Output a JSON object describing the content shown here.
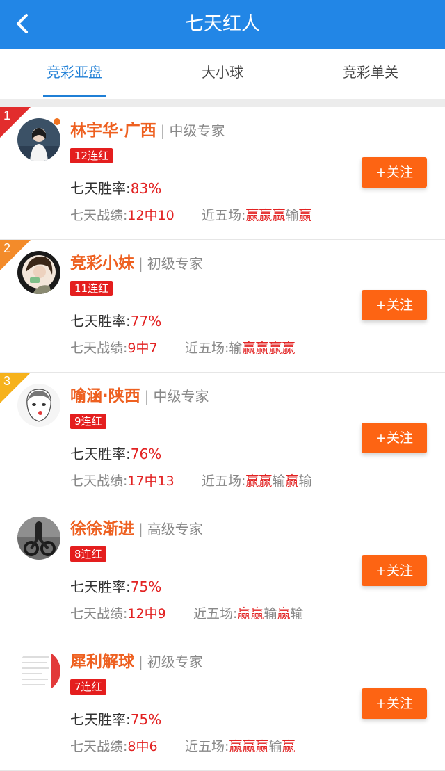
{
  "header": {
    "title": "七天红人",
    "back_icon": "chevron-left-icon",
    "color": "#2286e6"
  },
  "tabs": [
    {
      "label": "竞彩亚盘",
      "active": true
    },
    {
      "label": "大小球",
      "active": false
    },
    {
      "label": "竞彩单关",
      "active": false
    }
  ],
  "labels": {
    "winrate": "七天胜率:",
    "record": "七天战绩:",
    "recent": "近五场:",
    "follow": "+关注",
    "separator": "|"
  },
  "colors": {
    "accent": "#fd6413",
    "win": "#e22222",
    "tab_active": "#1f7fd6"
  },
  "experts": [
    {
      "rank": "1",
      "name": "林宇华·广西",
      "level": "中级专家",
      "streak": "12连红",
      "winrate": "83%",
      "record": "12中10",
      "recent": [
        "赢",
        "赢",
        "赢",
        "输",
        "赢"
      ],
      "online": true
    },
    {
      "rank": "2",
      "name": "竞彩小妹",
      "level": "初级专家",
      "streak": "11连红",
      "winrate": "77%",
      "record": "9中7",
      "recent": [
        "输",
        "赢",
        "赢",
        "赢",
        "赢"
      ],
      "online": false
    },
    {
      "rank": "3",
      "name": "喻涵·陕西",
      "level": "中级专家",
      "streak": "9连红",
      "winrate": "76%",
      "record": "17中13",
      "recent": [
        "赢",
        "赢",
        "输",
        "赢",
        "输"
      ],
      "online": false
    },
    {
      "rank": "",
      "name": "徐徐渐进",
      "level": "高级专家",
      "streak": "8连红",
      "winrate": "75%",
      "record": "12中9",
      "recent": [
        "赢",
        "赢",
        "输",
        "赢",
        "输"
      ],
      "online": false
    },
    {
      "rank": "",
      "name": "犀利解球",
      "level": "初级专家",
      "streak": "7连红",
      "winrate": "75%",
      "record": "8中6",
      "recent": [
        "赢",
        "赢",
        "赢",
        "输",
        "赢"
      ],
      "online": false
    }
  ]
}
